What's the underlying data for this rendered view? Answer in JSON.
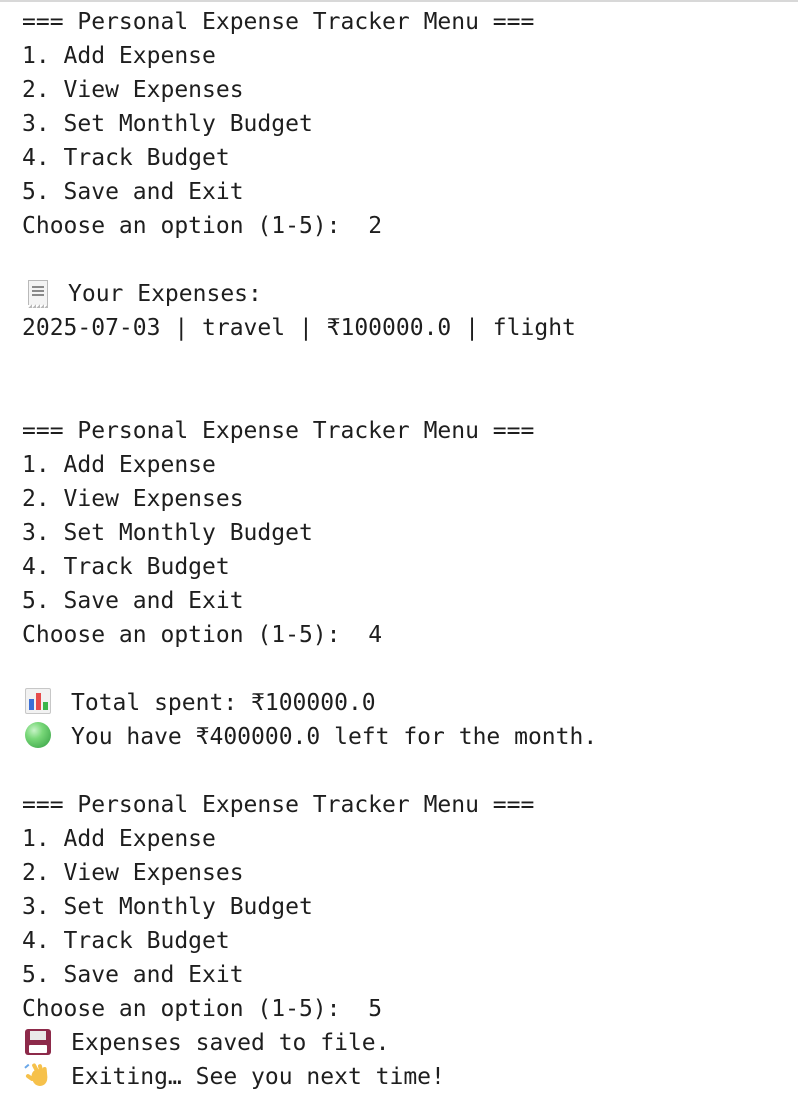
{
  "menu": {
    "title": "=== Personal Expense Tracker Menu ===",
    "options": [
      "1. Add Expense",
      "2. View Expenses",
      "3. Set Monthly Budget",
      "4. Track Budget",
      "5. Save and Exit"
    ],
    "prompt": "Choose an option (1-5):  "
  },
  "session": {
    "choice_1": "2",
    "choice_2": "4",
    "choice_3": "5"
  },
  "view": {
    "heading": "Your Expenses:",
    "heading_icon": "receipt-icon",
    "entries": [
      "2025-07-03 | travel | ₹100000.0 | flight"
    ]
  },
  "track": {
    "total": "Total spent: ₹100000.0",
    "total_icon": "bar-chart-icon",
    "remaining": "You have ₹400000.0 left for the month.",
    "remaining_icon": "green-circle-icon",
    "remaining_color": "#3bb54a"
  },
  "exit": {
    "saved": "Expenses saved to file.",
    "saved_icon": "floppy-disk-icon",
    "bye": "Exiting… See you next time!",
    "bye_icon": "waving-hand-icon"
  }
}
